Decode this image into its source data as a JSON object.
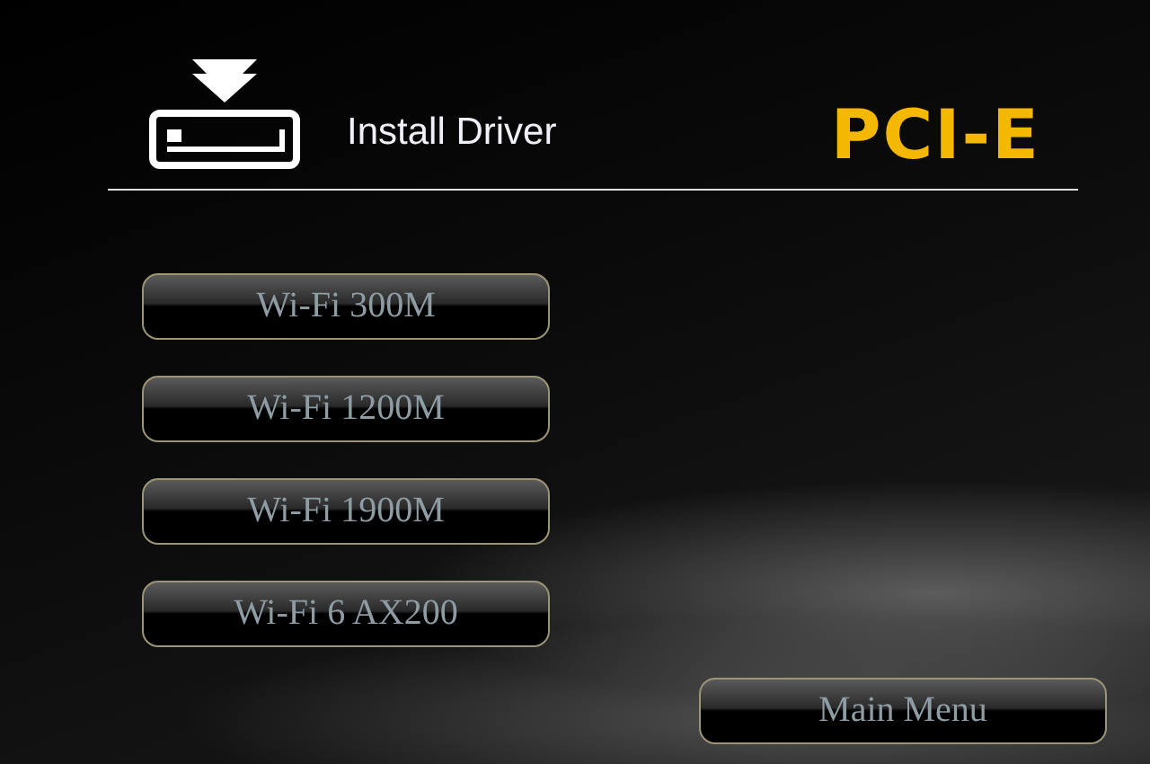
{
  "header": {
    "title": "Install Driver",
    "logo": "PCI-E"
  },
  "driver_buttons": [
    {
      "label": "Wi-Fi 300M"
    },
    {
      "label": "Wi-Fi 1200M"
    },
    {
      "label": "Wi-Fi 1900M"
    },
    {
      "label": "Wi-Fi 6 AX200"
    }
  ],
  "main_menu_button": {
    "label": "Main Menu"
  }
}
